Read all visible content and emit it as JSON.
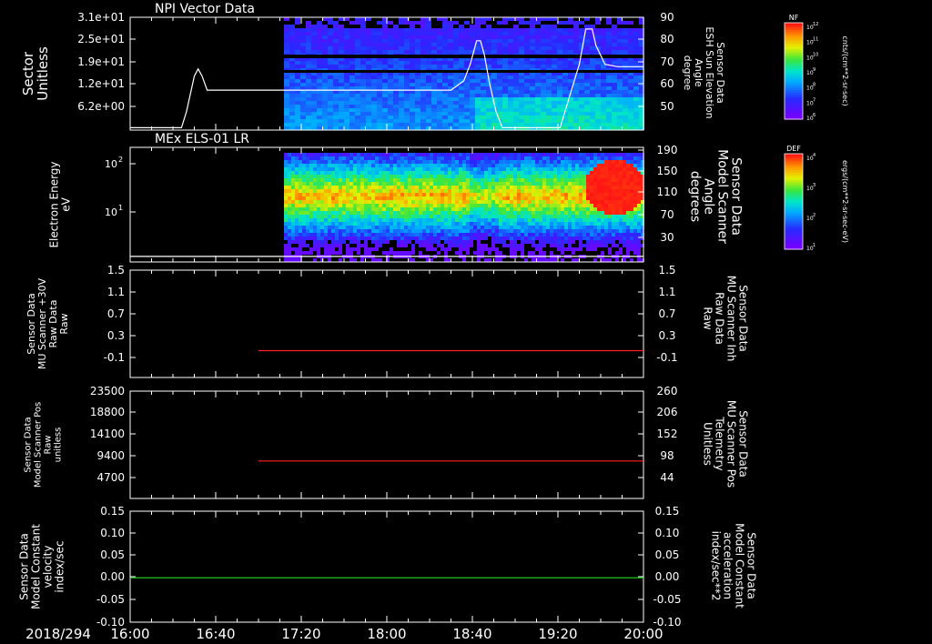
{
  "colors": {
    "white": "#ffffff",
    "red": "#ff2020",
    "green": "#22dd22",
    "background": "#000000"
  },
  "time_axis": {
    "date": "2018/294",
    "tick_labels": [
      "16:00",
      "16:40",
      "17:20",
      "18:00",
      "18:40",
      "19:20",
      "20:00"
    ],
    "x_range_hours": [
      16.0,
      20.0
    ]
  },
  "chart_data": [
    {
      "type": "heatmap",
      "title": "NPI Vector Data",
      "ylabel_left": [
        "Sector",
        "Unitless"
      ],
      "ylabel_right": [
        "Sensor Data",
        "ESH Sun Elevation",
        "Angle",
        "degree"
      ],
      "left_ticks": [
        "3.1e+01",
        "2.5e+01",
        "1.9e+01",
        "1.2e+01",
        "6.2e+00"
      ],
      "right_ticks": [
        "90",
        "80",
        "70",
        "60",
        "50"
      ],
      "right_ylim": [
        42,
        90
      ],
      "data_start_time": "17:12",
      "colorbar": {
        "label": "NF",
        "top": "10^12",
        "mid": [
          "10^11",
          "10^10",
          "10^9",
          "10^8",
          "10^7"
        ],
        "bottom": "10^6",
        "units": "cnts/(cm**2-sr-sec)"
      },
      "line_series": {
        "name": "ESH Sun Elevation Angle",
        "x_hours": [
          16.0,
          16.4,
          16.44,
          16.5,
          16.53,
          16.56,
          16.6,
          16.64,
          16.7,
          16.8,
          17.5,
          18.5,
          18.6,
          18.65,
          18.7,
          18.73,
          18.76,
          18.8,
          18.85,
          18.9,
          19.05,
          19.35,
          19.5,
          19.55,
          19.6,
          19.63,
          19.7,
          19.8,
          20.0
        ],
        "y": [
          43,
          43,
          50,
          65,
          68,
          65,
          59,
          59,
          59,
          59,
          59,
          59,
          63,
          70,
          80,
          80,
          74,
          62,
          50,
          43,
          43,
          43,
          70,
          85,
          85,
          78,
          70,
          69,
          69
        ]
      }
    },
    {
      "type": "heatmap",
      "title": "MEx ELS-01 LR",
      "ylabel_left": [
        "Electron Energy",
        "eV"
      ],
      "ylabel_right": [
        "Sensor Data",
        "Model Scanner",
        "Angle",
        "degrees"
      ],
      "left_ticks": [
        "10^2",
        "10^1"
      ],
      "right_ticks": [
        "190",
        "150",
        "110",
        "70",
        "30"
      ],
      "right_ylim": [
        5,
        190
      ],
      "data_start_time": "17:12",
      "colorbar": {
        "label": "DEF",
        "top": "10^4",
        "mid": [
          "10^3",
          "10^2"
        ],
        "bottom": "10^1",
        "units": "ergs/(cm**2-sr-sec-eV)"
      },
      "line_series": {
        "name": "Model Scanner Angle",
        "x_hours": [
          16.0,
          20.0
        ],
        "y": [
          14,
          14
        ]
      }
    },
    {
      "type": "line",
      "ylabel_left": [
        "Sensor Data",
        "MU Scanner +30V",
        "Raw Data",
        "Raw"
      ],
      "ylabel_right": [
        "Sensor Data",
        "MU Scanner Inh",
        "Raw Data",
        "Raw"
      ],
      "left_ticks": [
        "1.5",
        "1.1",
        "0.7",
        "0.3",
        "-0.1"
      ],
      "right_ticks": [
        "1.5",
        "1.1",
        "0.7",
        "0.3",
        "-0.1"
      ],
      "ylim": [
        -0.5,
        1.5
      ],
      "series": [
        {
          "name": "MU Scanner Inh Raw",
          "color": "#ff2020",
          "x_hours": [
            17.0,
            20.0
          ],
          "y": [
            0.0,
            0.0
          ]
        }
      ]
    },
    {
      "type": "line",
      "ylabel_left": [
        "Sensor Data",
        "Model Scanner Pos",
        "Raw",
        "unitless"
      ],
      "ylabel_right": [
        "Sensor Data",
        "MU Scanner Pos",
        "Telemetry",
        "Unitless"
      ],
      "left_ticks": [
        "23500",
        "18800",
        "14100",
        "9400",
        "4700"
      ],
      "right_ticks": [
        "260",
        "206",
        "152",
        "98",
        "44"
      ],
      "ylim": [
        0,
        23500
      ],
      "series": [
        {
          "name": "MU Scanner Pos Telemetry",
          "color": "#ff2020",
          "x_hours": [
            17.0,
            20.0
          ],
          "y": [
            8200,
            8200
          ]
        }
      ]
    },
    {
      "type": "line",
      "ylabel_left": [
        "Sensor Data",
        "Model Constant",
        "velocity",
        "index/sec"
      ],
      "ylabel_right": [
        "Sensor Data",
        "Model Constant",
        "acceleration",
        "index/sec**2"
      ],
      "left_ticks": [
        "0.15",
        "0.10",
        "0.05",
        "0.00",
        "-0.05",
        "-0.10"
      ],
      "right_ticks": [
        "0.15",
        "0.10",
        "0.05",
        "0.00",
        "-0.05",
        "-0.10"
      ],
      "ylim": [
        -0.1,
        0.15
      ],
      "series": [
        {
          "name": "Model Constant acceleration",
          "color": "#22dd22",
          "x_hours": [
            16.0,
            20.0
          ],
          "y": [
            0.0,
            0.0
          ]
        }
      ]
    }
  ]
}
